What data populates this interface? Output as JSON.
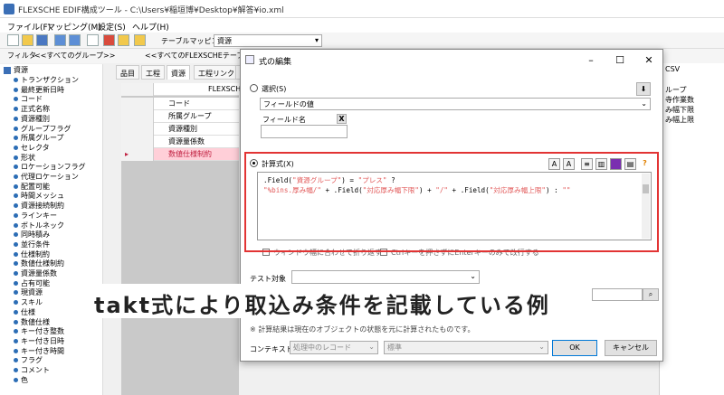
{
  "window": {
    "title": "FLEXSCHE EDIF構成ツール - C:\\Users¥稲垣博¥Desktop¥解答¥io.xml"
  },
  "menu": [
    "ファイル(F)",
    "マッピング(M)",
    "設定(S)",
    "ヘルプ(H)"
  ],
  "toolbar": {
    "mapping_label": "テーブルマッピング",
    "mapping_value": "資源"
  },
  "filterbar": {
    "filter_label": "フィルタ",
    "group_value": "<<すべてのグループ>>",
    "table_value": "<<すべてのFLEXSCHEテーブル>>"
  },
  "tree": {
    "root": "資源",
    "items": [
      "トランザクション",
      "最終更新日時",
      "コード",
      "正式名称",
      "資源種別",
      "グループフラグ",
      "所属グループ",
      "セレクタ",
      "形状",
      "ロケーションフラグ",
      "代理ロケーション",
      "配置可能",
      "時間メッシュ",
      "資源接続制約",
      "ラインキー",
      "ボトルネック",
      "同時積み",
      "並行条件",
      "仕様制約",
      "数値仕様制約",
      "資源量係数",
      "占有可能",
      "現資源",
      "スキル",
      "仕様",
      "数値仕様",
      "キー付き整数",
      "キー付き日時",
      "キー付き時間",
      "フラグ",
      "コメント",
      "色"
    ]
  },
  "middle": {
    "tabs": [
      "品目",
      "工程",
      "資源",
      "工程リンク",
      "諸"
    ],
    "header": "FLEXSCHE",
    "rows": [
      "コード",
      "所属グループ",
      "資源種別",
      "資源量係数",
      "数値仕様制約"
    ]
  },
  "right_panel": [
    "CSV",
    "ループ",
    "寺作業数",
    "み幅下限",
    "み幅上限"
  ],
  "dialog": {
    "title": "式の編集",
    "select_label": "選択(S)",
    "field_value_option": "フィールドの値",
    "field_name_label": "フィールド名",
    "calc_label": "計算式(X)",
    "expr_line1": ".Field(\"資源グループ\") = \"プレス\" ?",
    "expr_line2": "\"%bins.厚み幅/\" + .Field(\"対応厚み幅下限\") + \"/\" + .Field(\"対応厚み幅上限\") : \"\"",
    "wrap_label": "ウィンドウ幅に合わせて折り返す",
    "ctrl_enter_label": "Ctrlキーを押さずにEnterキーのみで改行する",
    "test_target_label": "テスト対象",
    "note": "※ 計算結果は現在のオブジェクトの状態を元に計算されたものです。",
    "context_label": "コンテキスト",
    "context_value": "処理中のレコード",
    "context_value2": "標準",
    "ok_label": "OK",
    "cancel_label": "キャンセル"
  },
  "caption": "takt式により取込み条件を記載している例",
  "colors": {
    "highlight": "#e23434",
    "string": "#e25a5a",
    "accent": "#3b6fb6"
  }
}
